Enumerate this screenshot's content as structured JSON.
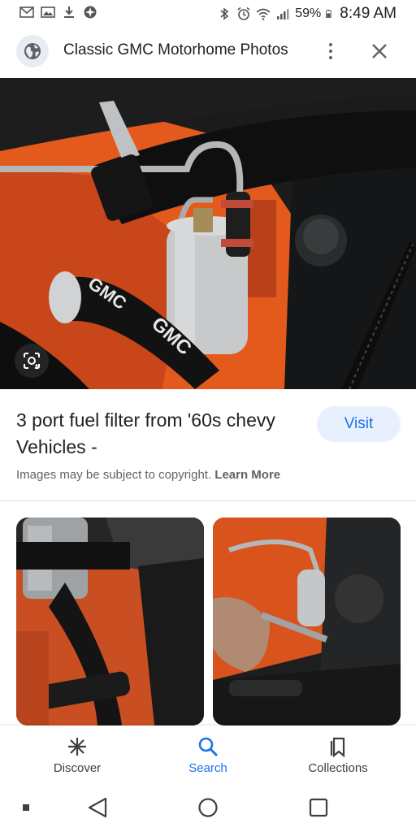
{
  "status_bar": {
    "battery_percent": "59%",
    "time": "8:49 AM",
    "left_icons": [
      "gmail-icon",
      "photo-icon",
      "download-icon",
      "pinwheel-icon"
    ],
    "right_icons": [
      "bluetooth-icon",
      "alarm-icon",
      "wifi-icon",
      "signal-icon",
      "battery-icon"
    ]
  },
  "header": {
    "title": "Classic GMC Motorhome Photos",
    "icons": [
      "globe-icon",
      "more-vert-icon",
      "close-icon"
    ]
  },
  "result": {
    "title": "3 port fuel filter from '60s chevy Vehicles -",
    "visit_label": "Visit",
    "copyright_text": "Images may be subject to copyright.",
    "learn_more": "Learn More"
  },
  "nav": {
    "items": [
      {
        "label": "Discover",
        "icon": "asterisk-icon",
        "active": false
      },
      {
        "label": "Search",
        "icon": "search-icon",
        "active": true
      },
      {
        "label": "Collections",
        "icon": "bookmarks-icon",
        "active": false
      }
    ]
  },
  "colors": {
    "accent": "#1a73e8",
    "visit_bg": "#e8f0fe",
    "engine_orange": "#e8571a"
  }
}
